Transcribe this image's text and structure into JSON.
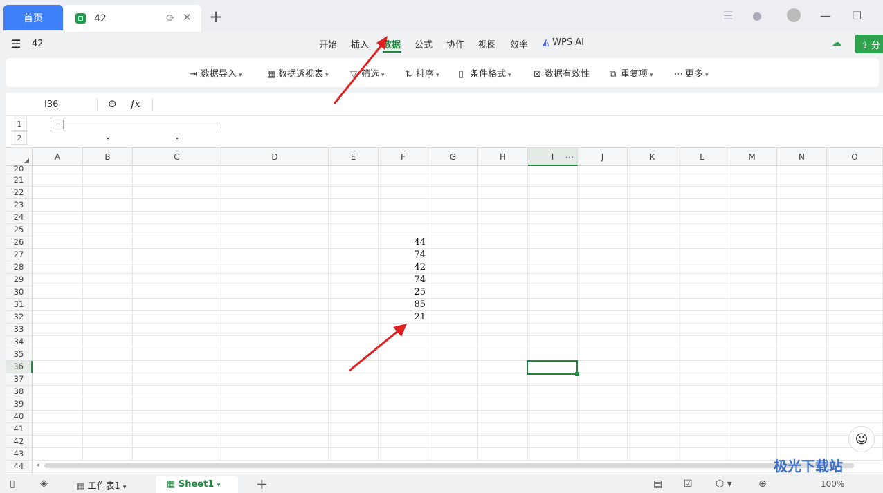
{
  "tabs": {
    "home": "首页",
    "doc_title": "42"
  },
  "header": {
    "doc_name": "42",
    "menu": [
      "开始",
      "插入",
      "数据",
      "公式",
      "协作",
      "视图",
      "效率",
      "WPS AI"
    ],
    "active_menu": "数据",
    "share": "分"
  },
  "ribbon": {
    "items": [
      "数据导入",
      "数据透视表",
      "筛选",
      "排序",
      "条件格式",
      "数据有效性",
      "重复项",
      "更多"
    ]
  },
  "formula": {
    "cell_ref": "I36",
    "fx": "fx"
  },
  "outline": {
    "levels": [
      "1",
      "2"
    ],
    "collapse": "−"
  },
  "columns": [
    "A",
    "B",
    "C",
    "D",
    "E",
    "F",
    "G",
    "H",
    "I",
    "J",
    "K",
    "L",
    "M",
    "N",
    "O"
  ],
  "rows": [
    "20",
    "21",
    "22",
    "23",
    "24",
    "25",
    "26",
    "27",
    "28",
    "29",
    "30",
    "31",
    "32",
    "33",
    "34",
    "35",
    "36",
    "37",
    "38",
    "39",
    "40",
    "41",
    "42",
    "43",
    "44"
  ],
  "cells_F": [
    "44",
    "74",
    "42",
    "74",
    "25",
    "85",
    "21"
  ],
  "selected_cell": "I36",
  "sheets": {
    "tab1": "工作表1",
    "tab2": "Sheet1"
  },
  "status": {
    "zoom": "100%"
  },
  "watermark": "极光下载站",
  "colors": {
    "accent": "#1f8a3f",
    "tab_blue": "#3c7ff8",
    "arrow": "#e02020"
  }
}
